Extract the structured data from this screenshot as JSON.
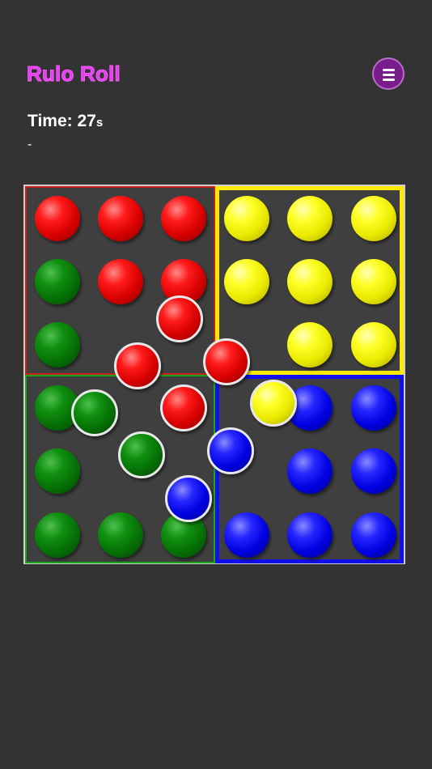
{
  "header": {
    "title": "Rulo Roll",
    "menu_icon": "hamburger-menu-icon"
  },
  "timer": {
    "label": "Time: 27",
    "unit": "s"
  },
  "status": {
    "text": "-"
  },
  "colors": {
    "background": "#333333",
    "title": "#e03ff0",
    "menu_button": "#7a1d8c",
    "red": "#ff1a1a",
    "yellow": "#ffff2a",
    "green": "#0f8f0f",
    "blue": "#2525ff"
  },
  "board": {
    "zones": [
      {
        "color": "red"
      },
      {
        "color": "yellow"
      },
      {
        "color": "green"
      },
      {
        "color": "blue"
      }
    ],
    "fixed_balls": [
      {
        "color": "red"
      },
      {
        "color": "red"
      },
      {
        "color": "red"
      },
      {
        "color": "green"
      },
      {
        "color": "red"
      },
      {
        "color": "red"
      },
      {
        "color": "green"
      },
      {
        "color": "yellow"
      },
      {
        "color": "yellow"
      },
      {
        "color": "yellow"
      },
      {
        "color": "yellow"
      },
      {
        "color": "yellow"
      },
      {
        "color": "yellow"
      },
      {
        "color": "yellow"
      },
      {
        "color": "yellow"
      },
      {
        "color": "green"
      },
      {
        "color": "green"
      },
      {
        "color": "green"
      },
      {
        "color": "green"
      },
      {
        "color": "green"
      },
      {
        "color": "blue"
      },
      {
        "color": "blue"
      },
      {
        "color": "blue"
      },
      {
        "color": "blue"
      },
      {
        "color": "blue"
      },
      {
        "color": "blue"
      },
      {
        "color": "blue"
      }
    ],
    "loose_balls": [
      {
        "color": "red"
      },
      {
        "color": "red"
      },
      {
        "color": "red"
      },
      {
        "color": "yellow"
      },
      {
        "color": "green"
      },
      {
        "color": "red"
      },
      {
        "color": "blue"
      },
      {
        "color": "green"
      },
      {
        "color": "blue"
      }
    ]
  }
}
